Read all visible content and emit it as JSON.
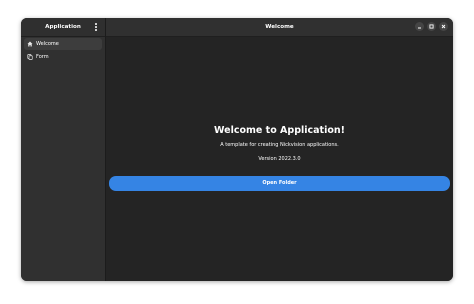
{
  "sidebar": {
    "title": "Application",
    "menu_icon": "view-more-icon",
    "items": [
      {
        "label": "Welcome",
        "icon": "home-icon",
        "selected": true
      },
      {
        "label": "Form",
        "icon": "document-copy-icon",
        "selected": false
      }
    ]
  },
  "header": {
    "title": "Welcome",
    "window_controls": [
      "minimize-icon",
      "maximize-icon",
      "close-icon"
    ]
  },
  "main": {
    "headline": "Welcome to Application!",
    "description": "A template for creating Nickvision applications.",
    "version": "Version 2022.3.0",
    "button_label": "Open Folder"
  },
  "colors": {
    "accent": "#3584e4",
    "background": "#242424",
    "headerbar": "#303030",
    "sidebar": "#303030",
    "selected_row": "#3d3d3d"
  }
}
